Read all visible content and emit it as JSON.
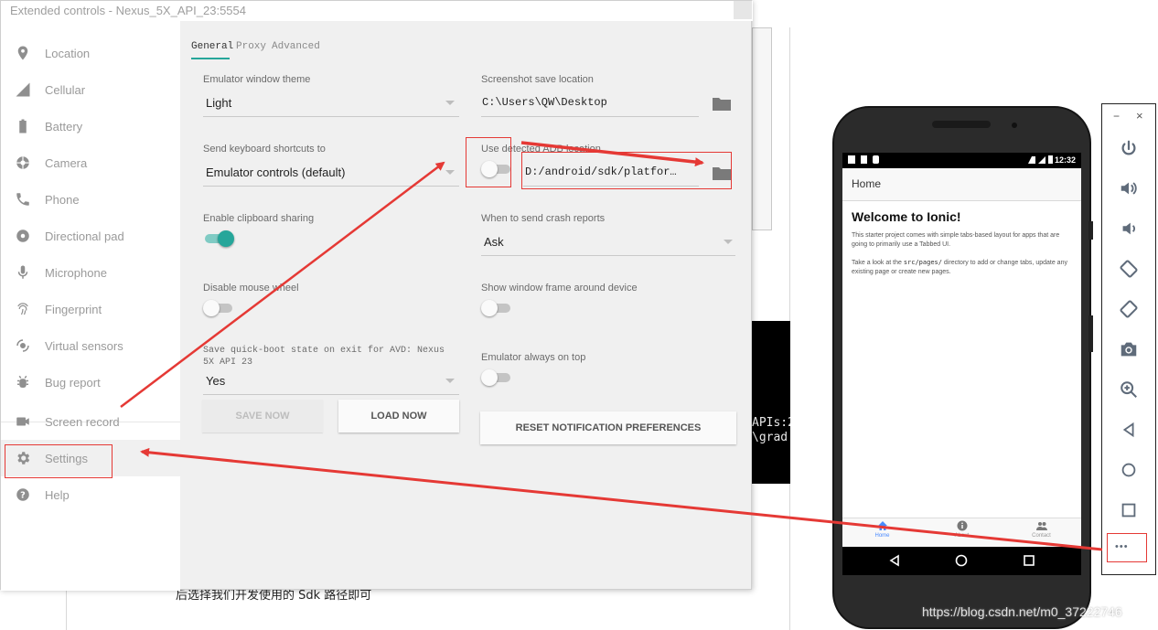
{
  "window": {
    "title": "Extended controls - Nexus_5X_API_23:5554"
  },
  "sidebar": {
    "items": [
      {
        "label": "Location",
        "icon": "location-pin-icon"
      },
      {
        "label": "Cellular",
        "icon": "cellular-signal-icon"
      },
      {
        "label": "Battery",
        "icon": "battery-icon"
      },
      {
        "label": "Camera",
        "icon": "camera-aperture-icon"
      },
      {
        "label": "Phone",
        "icon": "phone-icon"
      },
      {
        "label": "Directional pad",
        "icon": "dpad-icon"
      },
      {
        "label": "Microphone",
        "icon": "microphone-icon"
      },
      {
        "label": "Fingerprint",
        "icon": "fingerprint-icon"
      },
      {
        "label": "Virtual sensors",
        "icon": "sensors-icon"
      },
      {
        "label": "Bug report",
        "icon": "bug-icon"
      },
      {
        "label": "Screen record",
        "icon": "video-camera-icon"
      },
      {
        "label": "Settings",
        "icon": "gear-icon",
        "selected": true
      },
      {
        "label": "Help",
        "icon": "help-icon"
      }
    ]
  },
  "tabs": [
    {
      "label": "General",
      "active": true
    },
    {
      "label": "Proxy"
    },
    {
      "label": "Advanced"
    }
  ],
  "settings": {
    "theme_label": "Emulator window theme",
    "theme_value": "Light",
    "screenshot_label": "Screenshot save location",
    "screenshot_value": "C:\\Users\\QW\\Desktop",
    "shortcuts_label": "Send keyboard shortcuts to",
    "shortcuts_value": "Emulator controls (default)",
    "adb_label": "Use detected ADB location",
    "adb_value": "D:/android/sdk/platfor…",
    "clipboard_label": "Enable clipboard sharing",
    "crash_label": "When to send crash reports",
    "crash_value": "Ask",
    "mousewheel_label": "Disable mouse wheel",
    "frame_label": "Show window frame around device",
    "quickboot_label": "Save quick-boot state on exit for AVD: Nexus 5X API 23",
    "quickboot_value": "Yes",
    "ontop_label": "Emulator always on top",
    "save_now": "SAVE NOW",
    "load_now": "LOAD NOW",
    "reset_notifications": "RESET NOTIFICATION PREFERENCES",
    "toggles": {
      "adb": false,
      "clipboard": true,
      "mousewheel": false,
      "frame": false,
      "ontop": false
    }
  },
  "phone": {
    "status_time": "12:32",
    "app_title": "Home",
    "welcome": "Welcome to Ionic!",
    "para1": "This starter project comes with simple tabs-based layout for apps that are going to primarily use a Tabbed UI.",
    "para2_pre": "Take a look at the ",
    "para2_code": "src/pages/",
    "para2_post": " directory to add or change tabs, update any existing page or create new pages.",
    "tabs": [
      "Home",
      "About",
      "Contact"
    ]
  },
  "emulator_toolbar": {
    "minimize": "−",
    "close": "×",
    "more": "•••"
  },
  "background": {
    "terminal_line1": "APIs:2",
    "terminal_line2": "\\grad",
    "doc_text": "后选择我们开发使用的 Sdk 路径即可",
    "watermark": "https://blog.csdn.net/m0_37222746"
  },
  "colors": {
    "accent": "#26a69a",
    "annotation": "#e53935"
  }
}
